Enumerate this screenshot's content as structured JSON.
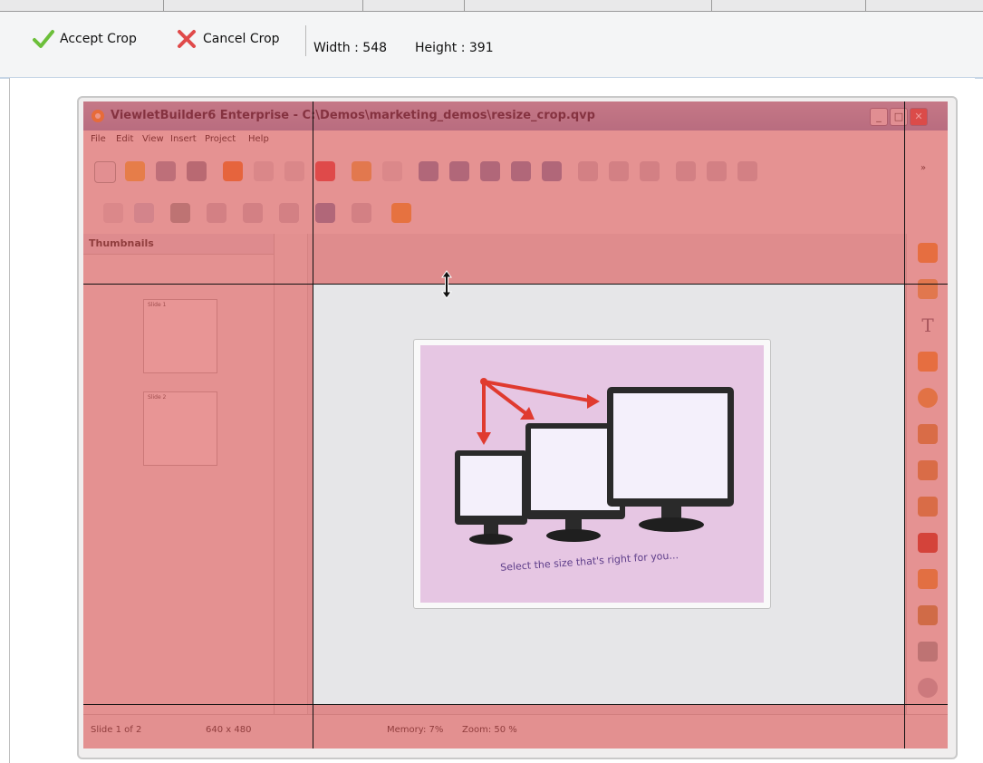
{
  "crop_toolbar": {
    "accept_label": "Accept Crop",
    "cancel_label": "Cancel Crop",
    "width_text": "Width : 548",
    "height_text": "Height : 391"
  },
  "app": {
    "title": "ViewletBuilder6 Enterprise - C:\\Demos\\marketing_demos\\resize_crop.qvp",
    "menu": [
      "File",
      "Edit",
      "View",
      "Insert",
      "Project",
      "Help"
    ],
    "thumbnails_title": "Thumbnails",
    "thumbs": [
      "Slide 1",
      "Slide 2"
    ],
    "slide_caption": "Select the size that's right for you...",
    "status": {
      "slide": "Slide 1 of 2",
      "resolution": "640 x 480",
      "memory": "Memory: 7%",
      "zoom": "Zoom: 50 %"
    }
  },
  "colors": {
    "overlay": "#dc4646",
    "accept": "#6cbf3a",
    "cancel": "#e04a4a",
    "slide_bg": "#e6c6e3"
  },
  "icons": [
    "check-icon",
    "x-icon",
    "resize-vertical-cursor-icon"
  ]
}
